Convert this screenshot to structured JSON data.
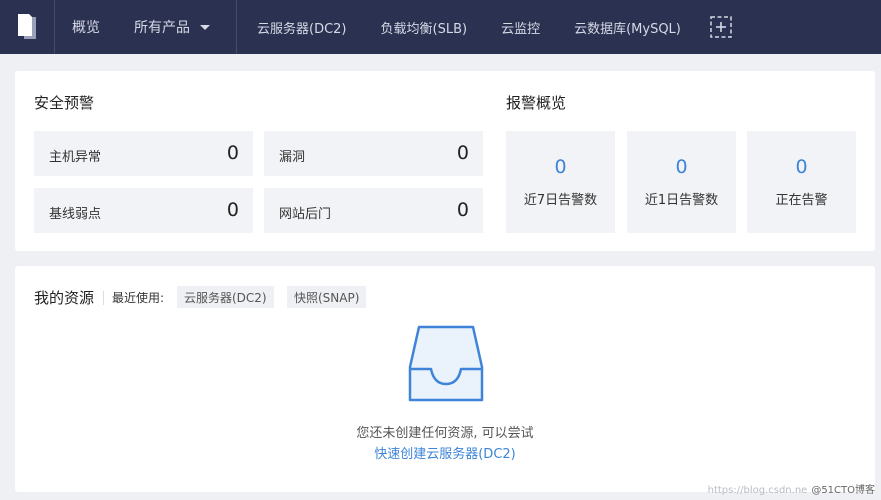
{
  "nav": {
    "overview": "概览",
    "products": "所有产品",
    "items": [
      "云服务器(DC2)",
      "负载均衡(SLB)",
      "云监控",
      "云数据库(MySQL)"
    ]
  },
  "security": {
    "title": "安全预警",
    "stats": [
      {
        "label": "主机异常",
        "value": "0"
      },
      {
        "label": "漏洞",
        "value": "0"
      },
      {
        "label": "基线弱点",
        "value": "0"
      },
      {
        "label": "网站后门",
        "value": "0"
      }
    ]
  },
  "alarm": {
    "title": "报警概览",
    "items": [
      {
        "value": "0",
        "label": "近7日告警数"
      },
      {
        "value": "0",
        "label": "近1日告警数"
      },
      {
        "value": "0",
        "label": "正在告警"
      }
    ]
  },
  "resources": {
    "title": "我的资源",
    "recent_label": "最近使用:",
    "recent": [
      "云服务器(DC2)",
      "快照(SNAP)"
    ],
    "empty_text": "您还未创建任何资源, 可以尝试",
    "empty_link": "快速创建云服务器(DC2)"
  },
  "watermark": {
    "faint": "https://blog.csdn.ne",
    "text": "@51CTO博客"
  },
  "colors": {
    "topbar": "#2b3151",
    "accent": "#3e84d8",
    "background": "#eef0f4"
  }
}
